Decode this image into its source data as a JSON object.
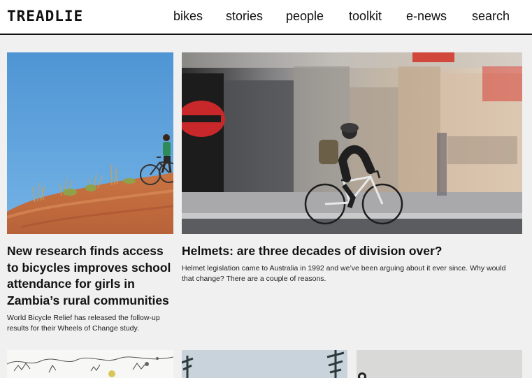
{
  "site": {
    "logo": "TREADLIE"
  },
  "nav": {
    "items": [
      {
        "label": "bikes"
      },
      {
        "label": "stories"
      },
      {
        "label": "people"
      },
      {
        "label": "toolkit"
      },
      {
        "label": "e-news"
      },
      {
        "label": "search"
      }
    ]
  },
  "articles": [
    {
      "image_subject": "girl-with-bicycle-on-red-dirt-hill",
      "headline": "New research finds access to bicycles improves school attendance for girls in Zambia’s rural communities",
      "summary": "World Bicycle Relief has released the follow-up results for their Wheels of Change study."
    },
    {
      "image_subject": "helmeted-cyclist-riding-past-blurred-shopfronts",
      "headline": "Helmets: are three decades of division over?",
      "summary": "Helmet legislation came to Australia in 1992 and we’ve been arguing about it ever since. Why would that change?  There are a couple of reasons."
    }
  ],
  "colors": {
    "accent": "#111111",
    "background": "#f0f0f0",
    "header_bg": "#ffffff"
  }
}
